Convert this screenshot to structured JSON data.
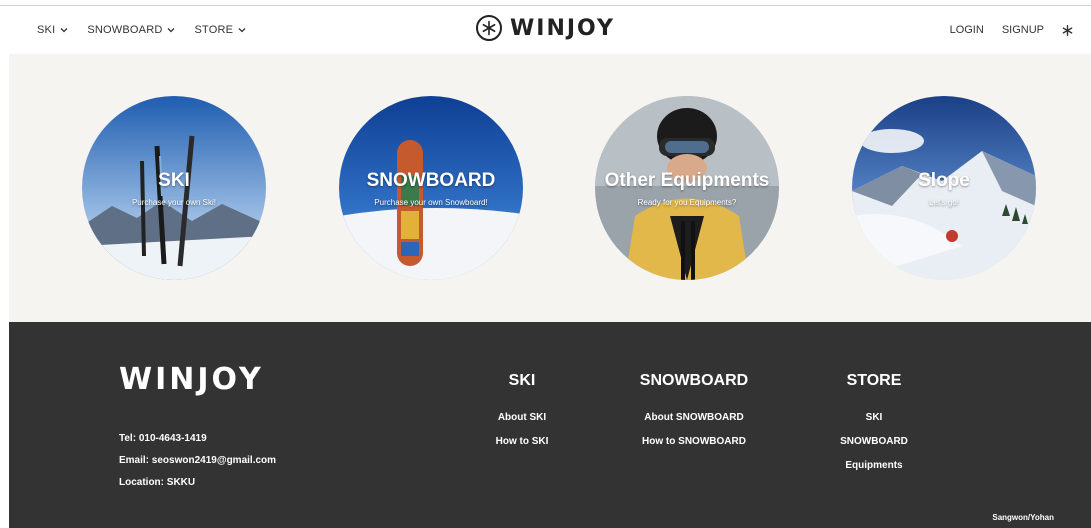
{
  "nav": {
    "left_items": [
      {
        "label": "SKI"
      },
      {
        "label": "SNOWBOARD"
      },
      {
        "label": "STORE"
      }
    ],
    "brand": "WINJOY",
    "login": "LOGIN",
    "signup": "SIGNUP"
  },
  "categories": [
    {
      "title": "SKI",
      "subtitle": "Purchase your own Ski!"
    },
    {
      "title": "SNOWBOARD",
      "subtitle": "Purchase your own Snowboard!"
    },
    {
      "title": "Other Equipments",
      "subtitle": "Ready for you Equipments?"
    },
    {
      "title": "Slope",
      "subtitle": "Let's go!"
    }
  ],
  "footer": {
    "brand": "WINJOY",
    "tel": "Tel: 010-4643-1419",
    "email": "Email: seoswon2419@gmail.com",
    "location": "Location: SKKU",
    "columns": [
      {
        "heading": "SKI",
        "links": [
          "About SKI",
          "How to SKI"
        ]
      },
      {
        "heading": "SNOWBOARD",
        "links": [
          "About SNOWBOARD",
          "How to SNOWBOARD"
        ]
      },
      {
        "heading": "STORE",
        "links": [
          "SKI",
          "SNOWBOARD",
          "Equipments"
        ]
      }
    ],
    "credit": "Sangwon/Yohan"
  },
  "colors": {
    "footer_bg": "#333333",
    "hero_bg": "#f5f4f0"
  }
}
